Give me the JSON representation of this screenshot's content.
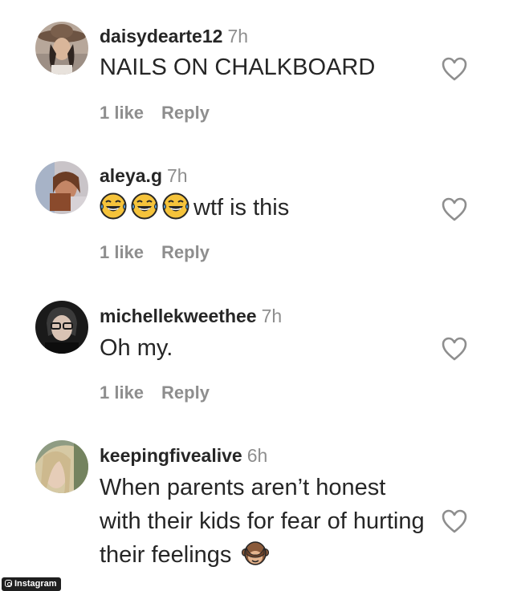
{
  "comments": [
    {
      "username": "daisydearte12",
      "time": "7h",
      "text": "NAILS ON CHALKBOARD",
      "likes": "1 like",
      "reply": "Reply",
      "avatar": "woman-with-hat-avatar"
    },
    {
      "username": "aleya.g",
      "time": "7h",
      "emojis": [
        "tears-of-joy-emoji",
        "tears-of-joy-emoji",
        "tears-of-joy-emoji"
      ],
      "text": "wtf is this",
      "likes": "1 like",
      "reply": "Reply",
      "avatar": "selfie-avatar"
    },
    {
      "username": "michellekweethee",
      "time": "7h",
      "text": "Oh my.",
      "likes": "1 like",
      "reply": "Reply",
      "avatar": "person-with-glasses-avatar"
    },
    {
      "username": "keepingfivealive",
      "time": "6h",
      "text": "When parents aren’t honest with their kids for fear of hurting their feelings",
      "trailing_emoji": "see-no-evil-monkey-emoji",
      "avatar": "blonde-woman-avatar"
    }
  ],
  "credit": {
    "label": "Instagram",
    "icon": "instagram-icon"
  },
  "colors": {
    "text": "#262626",
    "secondary": "#8e8e8e",
    "background": "#ffffff"
  }
}
